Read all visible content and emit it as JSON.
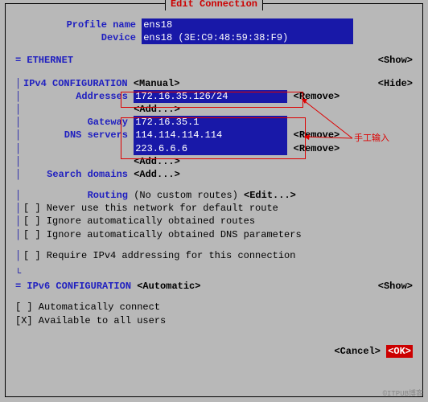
{
  "title": "Edit Connection",
  "profile": {
    "name_label": "Profile name",
    "name_value": "ens18                               ",
    "device_label": "Device",
    "device_value": "ens18 (3E:C9:48:59:38:F9)           "
  },
  "ethernet": {
    "label": "ETHERNET",
    "show": "<Show>"
  },
  "ipv4": {
    "label": "IPv4 CONFIGURATION",
    "mode": "<Manual>",
    "hide": "<Hide>",
    "addresses_label": "Addresses",
    "addresses_value": "172.16.35.126/24          ",
    "remove": "<Remove>",
    "add": "<Add...>",
    "gateway_label": "Gateway",
    "gateway_value": "172.16.35.1               ",
    "dns_label": "DNS servers",
    "dns1": "114.114.114.114           ",
    "dns2": "223.6.6.6                 ",
    "search_label": "Search domains",
    "routing_label": "Routing",
    "routing_value": "(No custom routes)",
    "edit": "<Edit...>",
    "opt1": "[ ] Never use this network for default route",
    "opt2": "[ ] Ignore automatically obtained routes",
    "opt3": "[ ] Ignore automatically obtained DNS parameters",
    "opt4": "[ ] Require IPv4 addressing for this connection"
  },
  "ipv6": {
    "label": "IPv6 CONFIGURATION",
    "mode": "<Automatic>",
    "show": "<Show>"
  },
  "global": {
    "auto": "[ ] Automatically connect",
    "avail": "[X] Available to all users"
  },
  "buttons": {
    "cancel": "<Cancel>",
    "ok": "<OK>"
  },
  "anno": "手工输入",
  "watermark": "©ITPUB博客"
}
